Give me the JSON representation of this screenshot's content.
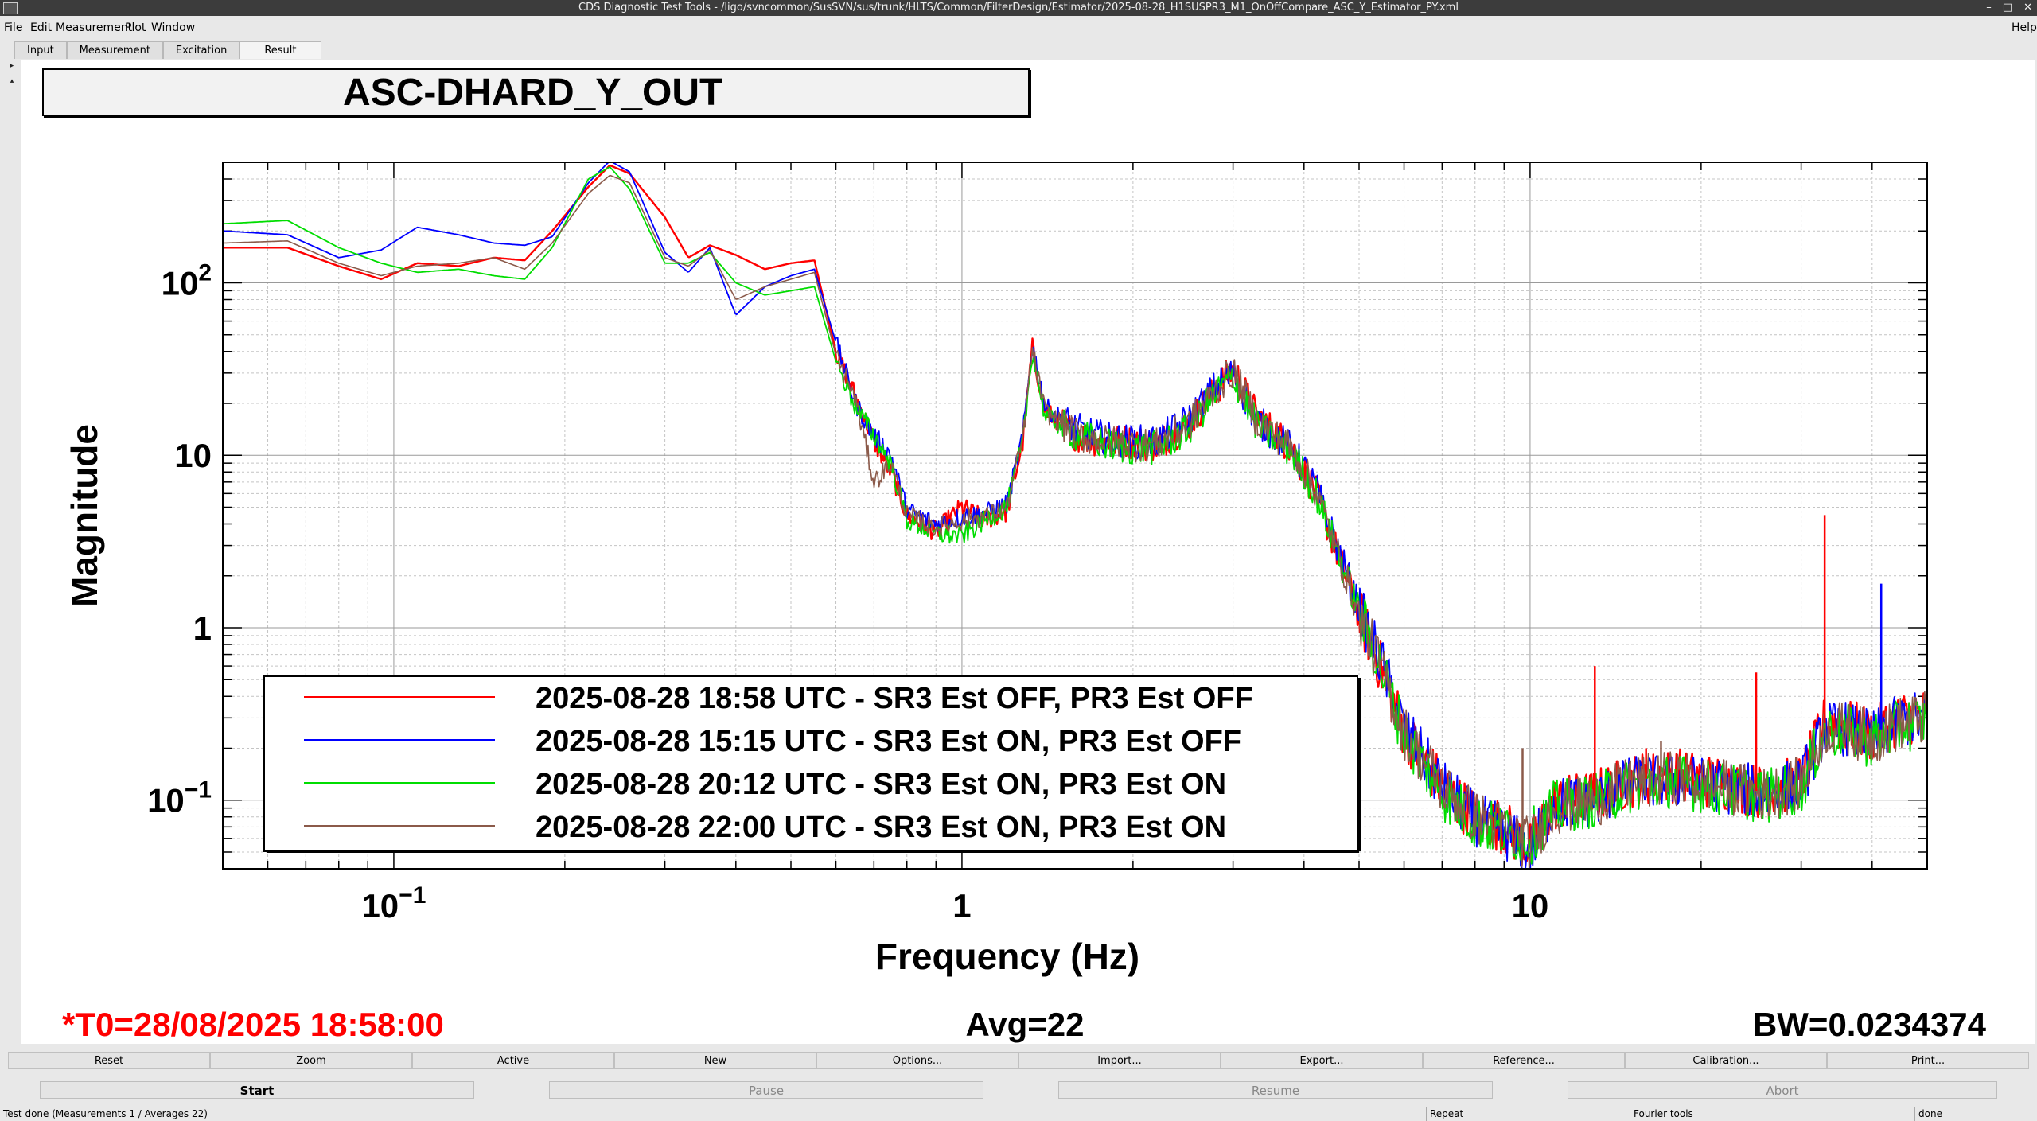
{
  "window": {
    "title": "CDS Diagnostic Test Tools - /ligo/svncommon/SusSVN/sus/trunk/HLTS/Common/FilterDesign/Estimator/2025-08-28_H1SUSPR3_M1_OnOffCompare_ASC_Y_Estimator_PY.xml",
    "controls": [
      "–",
      "□",
      "✕"
    ]
  },
  "menu": {
    "file": "File",
    "edit": "Edit",
    "measurement": "Measurement",
    "plot": "Plot",
    "window": "Window",
    "help": "Help"
  },
  "tabs": [
    "Input",
    "Measurement",
    "Excitation",
    "Result"
  ],
  "plot": {
    "title": "ASC-DHARD_Y_OUT",
    "t0": "*T0=28/08/2025 18:58:00",
    "avg": "Avg=22",
    "bw": "BW=0.0234374"
  },
  "colors": {
    "red": "#ff0000",
    "blue": "#0000ff",
    "green": "#00dd00",
    "brown": "#8b5a4a"
  },
  "chart_data": {
    "type": "line",
    "xscale": "log",
    "yscale": "log",
    "xlim": [
      0.05,
      50
    ],
    "ylim": [
      0.04,
      500
    ],
    "xlabel": "Frequency (Hz)",
    "ylabel": "Magnitude",
    "x_ticks": [
      {
        "value": 0.1,
        "base": "10",
        "exp": "−1"
      },
      {
        "value": 1,
        "base": "1",
        "exp": ""
      },
      {
        "value": 10,
        "base": "10",
        "exp": ""
      }
    ],
    "y_ticks": [
      {
        "value": 100,
        "base": "10",
        "exp": "2"
      },
      {
        "value": 10,
        "base": "10",
        "exp": ""
      },
      {
        "value": 1,
        "base": "1",
        "exp": ""
      },
      {
        "value": 0.1,
        "base": "10",
        "exp": "−1"
      }
    ],
    "grid": true,
    "legend_position": "lower-left",
    "series": [
      {
        "name": "2025-08-28 18:58 UTC - SR3 Est OFF, PR3 Est OFF",
        "color": "#ff0000",
        "width": 2.4,
        "points": [
          [
            0.05,
            160
          ],
          [
            0.065,
            160
          ],
          [
            0.08,
            125
          ],
          [
            0.095,
            105
          ],
          [
            0.11,
            130
          ],
          [
            0.13,
            125
          ],
          [
            0.15,
            140
          ],
          [
            0.17,
            135
          ],
          [
            0.19,
            200
          ],
          [
            0.22,
            360
          ],
          [
            0.24,
            480
          ],
          [
            0.26,
            430
          ],
          [
            0.3,
            240
          ],
          [
            0.33,
            140
          ],
          [
            0.36,
            165
          ],
          [
            0.4,
            145
          ],
          [
            0.45,
            120
          ],
          [
            0.5,
            130
          ],
          [
            0.55,
            135
          ],
          [
            0.6,
            40
          ],
          [
            0.65,
            22
          ],
          [
            0.7,
            12
          ],
          [
            0.75,
            8
          ],
          [
            0.8,
            4.5
          ],
          [
            0.9,
            3.6
          ],
          [
            1.0,
            5
          ],
          [
            1.1,
            4.2
          ],
          [
            1.2,
            4.7
          ],
          [
            1.28,
            12
          ],
          [
            1.33,
            42
          ],
          [
            1.4,
            18
          ],
          [
            1.6,
            13
          ],
          [
            1.8,
            12
          ],
          [
            2.0,
            12
          ],
          [
            2.2,
            11.5
          ],
          [
            2.5,
            15
          ],
          [
            2.8,
            24
          ],
          [
            3.0,
            32
          ],
          [
            3.3,
            17
          ],
          [
            3.8,
            11
          ],
          [
            4.2,
            6
          ],
          [
            5.0,
            1.2
          ],
          [
            5.5,
            0.55
          ],
          [
            6.0,
            0.25
          ],
          [
            7.0,
            0.12
          ],
          [
            8.0,
            0.08
          ],
          [
            9.0,
            0.07
          ],
          [
            10.0,
            0.052
          ],
          [
            11.0,
            0.095
          ],
          [
            13.0,
            0.105
          ],
          [
            15.0,
            0.13
          ],
          [
            18.0,
            0.14
          ],
          [
            22.0,
            0.125
          ],
          [
            26.0,
            0.11
          ],
          [
            30.0,
            0.13
          ],
          [
            33.0,
            0.28
          ],
          [
            36.0,
            0.27
          ],
          [
            40.0,
            0.24
          ],
          [
            45.0,
            0.3
          ],
          [
            50.0,
            0.31
          ]
        ]
      },
      {
        "name": "2025-08-28 15:15 UTC - SR3 Est ON, PR3 Est OFF",
        "color": "#0000ff",
        "width": 1.8,
        "points": [
          [
            0.05,
            200
          ],
          [
            0.065,
            190
          ],
          [
            0.08,
            140
          ],
          [
            0.095,
            155
          ],
          [
            0.11,
            210
          ],
          [
            0.13,
            190
          ],
          [
            0.15,
            170
          ],
          [
            0.17,
            165
          ],
          [
            0.19,
            185
          ],
          [
            0.22,
            380
          ],
          [
            0.24,
            510
          ],
          [
            0.26,
            440
          ],
          [
            0.3,
            150
          ],
          [
            0.33,
            115
          ],
          [
            0.36,
            160
          ],
          [
            0.4,
            65
          ],
          [
            0.45,
            95
          ],
          [
            0.5,
            110
          ],
          [
            0.55,
            120
          ],
          [
            0.6,
            45
          ],
          [
            0.65,
            20
          ],
          [
            0.7,
            13
          ],
          [
            0.75,
            10
          ],
          [
            0.8,
            4.8
          ],
          [
            0.9,
            4.0
          ],
          [
            1.0,
            4.4
          ],
          [
            1.1,
            4.6
          ],
          [
            1.2,
            5.2
          ],
          [
            1.28,
            13
          ],
          [
            1.33,
            44
          ],
          [
            1.4,
            19
          ],
          [
            1.6,
            14
          ],
          [
            1.8,
            12.5
          ],
          [
            2.0,
            12
          ],
          [
            2.2,
            12
          ],
          [
            2.5,
            16
          ],
          [
            2.8,
            25
          ],
          [
            3.0,
            30
          ],
          [
            3.3,
            16
          ],
          [
            3.8,
            11
          ],
          [
            4.2,
            6.5
          ],
          [
            5.0,
            1.3
          ],
          [
            5.5,
            0.6
          ],
          [
            6.0,
            0.26
          ],
          [
            7.0,
            0.12
          ],
          [
            8.0,
            0.078
          ],
          [
            9.0,
            0.065
          ],
          [
            10.0,
            0.05
          ],
          [
            11.0,
            0.095
          ],
          [
            13.0,
            0.1
          ],
          [
            15.0,
            0.125
          ],
          [
            18.0,
            0.13
          ],
          [
            22.0,
            0.12
          ],
          [
            26.0,
            0.11
          ],
          [
            30.0,
            0.125
          ],
          [
            33.0,
            0.26
          ],
          [
            36.0,
            0.26
          ],
          [
            40.0,
            0.23
          ],
          [
            45.0,
            0.29
          ],
          [
            50.0,
            0.3
          ]
        ]
      },
      {
        "name": "2025-08-28 20:12 UTC - SR3 Est ON, PR3 Est ON",
        "color": "#00dd00",
        "width": 1.8,
        "points": [
          [
            0.05,
            220
          ],
          [
            0.065,
            230
          ],
          [
            0.08,
            160
          ],
          [
            0.095,
            130
          ],
          [
            0.11,
            115
          ],
          [
            0.13,
            120
          ],
          [
            0.15,
            110
          ],
          [
            0.17,
            105
          ],
          [
            0.19,
            160
          ],
          [
            0.22,
            400
          ],
          [
            0.24,
            470
          ],
          [
            0.26,
            350
          ],
          [
            0.3,
            130
          ],
          [
            0.33,
            130
          ],
          [
            0.36,
            150
          ],
          [
            0.4,
            100
          ],
          [
            0.45,
            85
          ],
          [
            0.5,
            90
          ],
          [
            0.55,
            95
          ],
          [
            0.6,
            35
          ],
          [
            0.65,
            19
          ],
          [
            0.7,
            13
          ],
          [
            0.75,
            9
          ],
          [
            0.8,
            4.2
          ],
          [
            0.9,
            3.5
          ],
          [
            1.0,
            3.4
          ],
          [
            1.1,
            4.2
          ],
          [
            1.2,
            5
          ],
          [
            1.28,
            12
          ],
          [
            1.33,
            40
          ],
          [
            1.4,
            17
          ],
          [
            1.6,
            13
          ],
          [
            1.8,
            11.5
          ],
          [
            2.0,
            11
          ],
          [
            2.2,
            11
          ],
          [
            2.5,
            14
          ],
          [
            2.8,
            23
          ],
          [
            3.0,
            29
          ],
          [
            3.3,
            15
          ],
          [
            3.8,
            10.5
          ],
          [
            4.2,
            6
          ],
          [
            5.0,
            1.25
          ],
          [
            5.5,
            0.55
          ],
          [
            6.0,
            0.24
          ],
          [
            7.0,
            0.11
          ],
          [
            8.0,
            0.075
          ],
          [
            9.0,
            0.065
          ],
          [
            10.0,
            0.06
          ],
          [
            11.0,
            0.09
          ],
          [
            13.0,
            0.1
          ],
          [
            15.0,
            0.12
          ],
          [
            18.0,
            0.13
          ],
          [
            22.0,
            0.115
          ],
          [
            26.0,
            0.105
          ],
          [
            30.0,
            0.12
          ],
          [
            33.0,
            0.25
          ],
          [
            36.0,
            0.25
          ],
          [
            40.0,
            0.22
          ],
          [
            45.0,
            0.27
          ],
          [
            50.0,
            0.29
          ]
        ]
      },
      {
        "name": "2025-08-28 22:00 UTC - SR3 Est ON, PR3 Est ON",
        "color": "#8b5a4a",
        "width": 1.6,
        "points": [
          [
            0.05,
            170
          ],
          [
            0.065,
            175
          ],
          [
            0.08,
            130
          ],
          [
            0.095,
            110
          ],
          [
            0.11,
            125
          ],
          [
            0.13,
            130
          ],
          [
            0.15,
            140
          ],
          [
            0.17,
            120
          ],
          [
            0.19,
            170
          ],
          [
            0.22,
            330
          ],
          [
            0.24,
            420
          ],
          [
            0.26,
            380
          ],
          [
            0.3,
            140
          ],
          [
            0.33,
            125
          ],
          [
            0.36,
            155
          ],
          [
            0.4,
            80
          ],
          [
            0.45,
            95
          ],
          [
            0.5,
            105
          ],
          [
            0.55,
            115
          ],
          [
            0.6,
            38
          ],
          [
            0.65,
            21
          ],
          [
            0.7,
            7
          ],
          [
            0.75,
            9
          ],
          [
            0.8,
            4.5
          ],
          [
            0.9,
            3.8
          ],
          [
            1.0,
            4.2
          ],
          [
            1.1,
            4.4
          ],
          [
            1.2,
            5
          ],
          [
            1.28,
            12.5
          ],
          [
            1.33,
            41
          ],
          [
            1.4,
            18
          ],
          [
            1.6,
            13
          ],
          [
            1.8,
            12
          ],
          [
            2.0,
            11.5
          ],
          [
            2.2,
            11.5
          ],
          [
            2.5,
            15
          ],
          [
            2.8,
            24
          ],
          [
            3.0,
            31
          ],
          [
            3.3,
            16
          ],
          [
            3.8,
            11
          ],
          [
            4.2,
            6.2
          ],
          [
            5.0,
            1.2
          ],
          [
            5.5,
            0.55
          ],
          [
            6.0,
            0.25
          ],
          [
            7.0,
            0.12
          ],
          [
            8.0,
            0.08
          ],
          [
            9.0,
            0.068
          ],
          [
            10.0,
            0.055
          ],
          [
            11.0,
            0.09
          ],
          [
            13.0,
            0.1
          ],
          [
            15.0,
            0.125
          ],
          [
            18.0,
            0.135
          ],
          [
            22.0,
            0.12
          ],
          [
            26.0,
            0.108
          ],
          [
            30.0,
            0.125
          ],
          [
            33.0,
            0.26
          ],
          [
            36.0,
            0.26
          ],
          [
            40.0,
            0.23
          ],
          [
            45.0,
            0.28
          ],
          [
            50.0,
            0.3
          ]
        ]
      }
    ],
    "peaks": [
      {
        "x": 9.7,
        "y": 0.2,
        "color": "#8b5a4a"
      },
      {
        "x": 13.0,
        "y": 0.6,
        "color": "#ff0000"
      },
      {
        "x": 15.0,
        "y": 0.17,
        "color": "#8b5a4a"
      },
      {
        "x": 16.0,
        "y": 0.2,
        "color": "#ff0000"
      },
      {
        "x": 17.0,
        "y": 0.22,
        "color": "#8b5a4a"
      },
      {
        "x": 25.0,
        "y": 0.55,
        "color": "#ff0000"
      },
      {
        "x": 33.0,
        "y": 4.5,
        "color": "#ff0000"
      },
      {
        "x": 41.5,
        "y": 1.8,
        "color": "#0000ff"
      }
    ]
  },
  "buttons": [
    "Reset",
    "Zoom",
    "Active",
    "New",
    "Options...",
    "Import...",
    "Export...",
    "Reference...",
    "Calibration...",
    "Print..."
  ],
  "run_buttons": [
    "Start",
    "Pause",
    "Resume",
    "Abort"
  ],
  "status": {
    "message": "Test done (Measurements 1 / Averages 22)",
    "repeat": "Repeat",
    "fourier": "Fourier tools",
    "state": "done"
  }
}
